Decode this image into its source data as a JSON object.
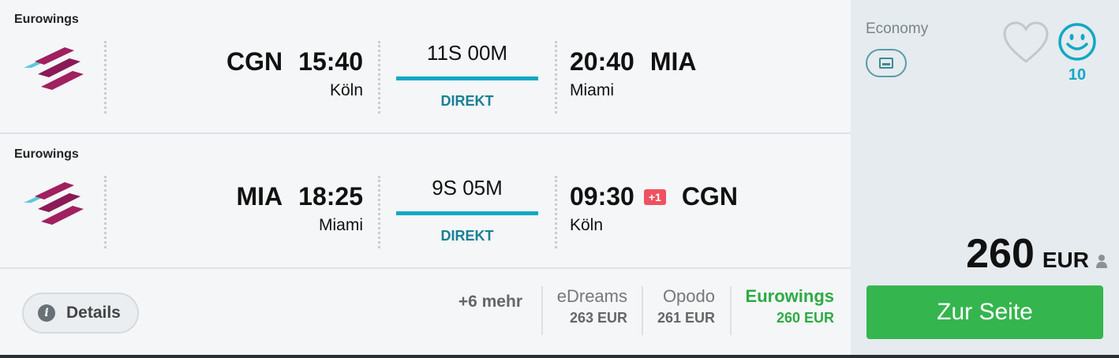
{
  "legs": [
    {
      "airline": "Eurowings",
      "dep_code": "CGN",
      "dep_time": "15:40",
      "dep_city": "Köln",
      "duration": "11S 00M",
      "stops": "DIREKT",
      "arr_time": "20:40",
      "arr_code": "MIA",
      "arr_city": "Miami",
      "day_offset": ""
    },
    {
      "airline": "Eurowings",
      "dep_code": "MIA",
      "dep_time": "18:25",
      "dep_city": "Miami",
      "duration": "9S 05M",
      "stops": "DIREKT",
      "arr_time": "09:30",
      "arr_code": "CGN",
      "arr_city": "Köln",
      "day_offset": "+1"
    }
  ],
  "footer": {
    "details_label": "Details",
    "more_label": "+6 mehr",
    "providers": [
      {
        "name": "eDreams",
        "price": "263 EUR"
      },
      {
        "name": "Opodo",
        "price": "261 EUR"
      },
      {
        "name": "Eurowings",
        "price": "260 EUR"
      }
    ]
  },
  "sidebar": {
    "cabin": "Economy",
    "score": "10",
    "price_amount": "260",
    "price_currency": "EUR",
    "cta_label": "Zur Seite"
  },
  "colors": {
    "accent": "#12a8c4",
    "cta": "#35b54e",
    "best_provider": "#2eaa45",
    "day_badge": "#f05060"
  },
  "icons": [
    "airline-logo-icon",
    "info-icon",
    "seat-card-icon",
    "heart-icon",
    "smiley-icon",
    "person-icon"
  ]
}
